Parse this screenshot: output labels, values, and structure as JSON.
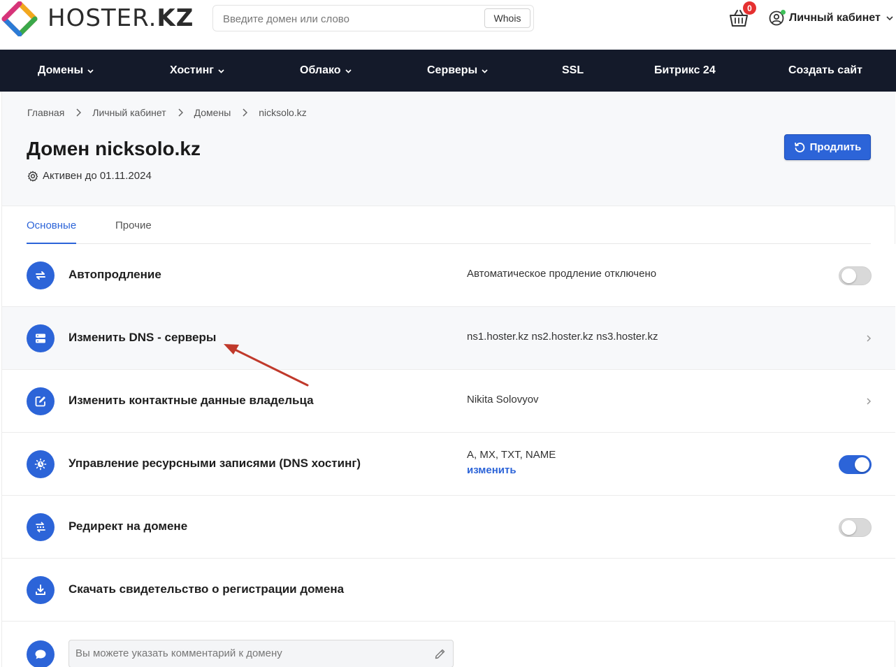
{
  "header": {
    "logo_text_light": "HOSTER.",
    "logo_text_bold": "KZ",
    "search_placeholder": "Введите домен или слово",
    "whois_label": "Whois",
    "cart_count": "0",
    "account_label": "Личный кабинет"
  },
  "nav": {
    "items": [
      {
        "label": "Домены",
        "has_dropdown": true
      },
      {
        "label": "Хостинг",
        "has_dropdown": true
      },
      {
        "label": "Облако",
        "has_dropdown": true
      },
      {
        "label": "Серверы",
        "has_dropdown": true
      },
      {
        "label": "SSL",
        "has_dropdown": false
      },
      {
        "label": "Битрикс 24",
        "has_dropdown": false
      },
      {
        "label": "Создать сайт",
        "has_dropdown": false
      }
    ]
  },
  "breadcrumb": [
    "Главная",
    "Личный кабинет",
    "Домены",
    "nicksolo.kz"
  ],
  "page": {
    "title": "Домен nicksolo.kz",
    "status": "Активен до 01.11.2024",
    "renew_label": "Продлить"
  },
  "tabs": [
    {
      "label": "Основные",
      "active": true
    },
    {
      "label": "Прочие",
      "active": false
    }
  ],
  "rows": [
    {
      "icon": "sync-icon",
      "label": "Автопродление",
      "value": "Автоматическое продление отключено",
      "control": "toggle",
      "toggle_on": false
    },
    {
      "icon": "server-icon",
      "label": "Изменить DNS - серверы",
      "value": "ns1.hoster.kz ns2.hoster.kz ns3.hoster.kz",
      "control": "chevron"
    },
    {
      "icon": "edit-icon",
      "label": "Изменить контактные данные владельца",
      "value": "Nikita Solovyov",
      "control": "chevron"
    },
    {
      "icon": "dns-hosting-icon",
      "label": "Управление ресурсными записями (DNS хостинг)",
      "value": "A, MX, TXT, NAME",
      "link": "изменить",
      "control": "toggle",
      "toggle_on": true
    },
    {
      "icon": "redirect-icon",
      "label": "Редирект на домене",
      "value": "",
      "control": "toggle",
      "toggle_on": false
    },
    {
      "icon": "download-icon",
      "label": "Скачать свидетельство о регистрации домена",
      "value": "",
      "control": "none"
    }
  ],
  "comment": {
    "placeholder": "Вы можете указать комментарий к домену"
  },
  "colors": {
    "accent": "#2c64d8",
    "nav_bg": "#141a2a",
    "badge": "#e53030",
    "annotation_arrow": "#c0392b"
  }
}
